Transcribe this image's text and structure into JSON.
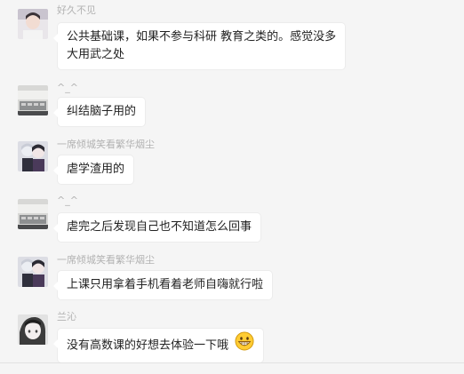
{
  "messages": [
    {
      "sender": "好久不见",
      "lines": [
        "公共基础课，如果不参与科研  教育之类的。感觉没多",
        "大用武之处"
      ],
      "avatar": "person-photo"
    },
    {
      "sender": "^_^",
      "lines": [
        "纠结脑子用的"
      ],
      "avatar": "keyboard-photo"
    },
    {
      "sender": "一席倾城笑看繁华烟尘",
      "lines": [
        "虐学渣用的"
      ],
      "avatar": "anime-couple"
    },
    {
      "sender": "^_^",
      "lines": [
        "虐完之后发现自己也不知道怎么回事"
      ],
      "avatar": "keyboard-photo"
    },
    {
      "sender": "一席倾城笑看繁华烟尘",
      "lines": [
        "上课只用拿着手机看着老师自嗨就行啦"
      ],
      "avatar": "anime-couple"
    },
    {
      "sender": "兰沁",
      "lines": [
        "没有高数课的好想去体验一下哦"
      ],
      "avatar": "anime-girl",
      "emoji": "grinning-face-icon"
    }
  ],
  "colors": {
    "background": "#f5f5f5",
    "bubble": "#ffffff",
    "sender_name": "#b2b2b2",
    "text": "#222222"
  }
}
